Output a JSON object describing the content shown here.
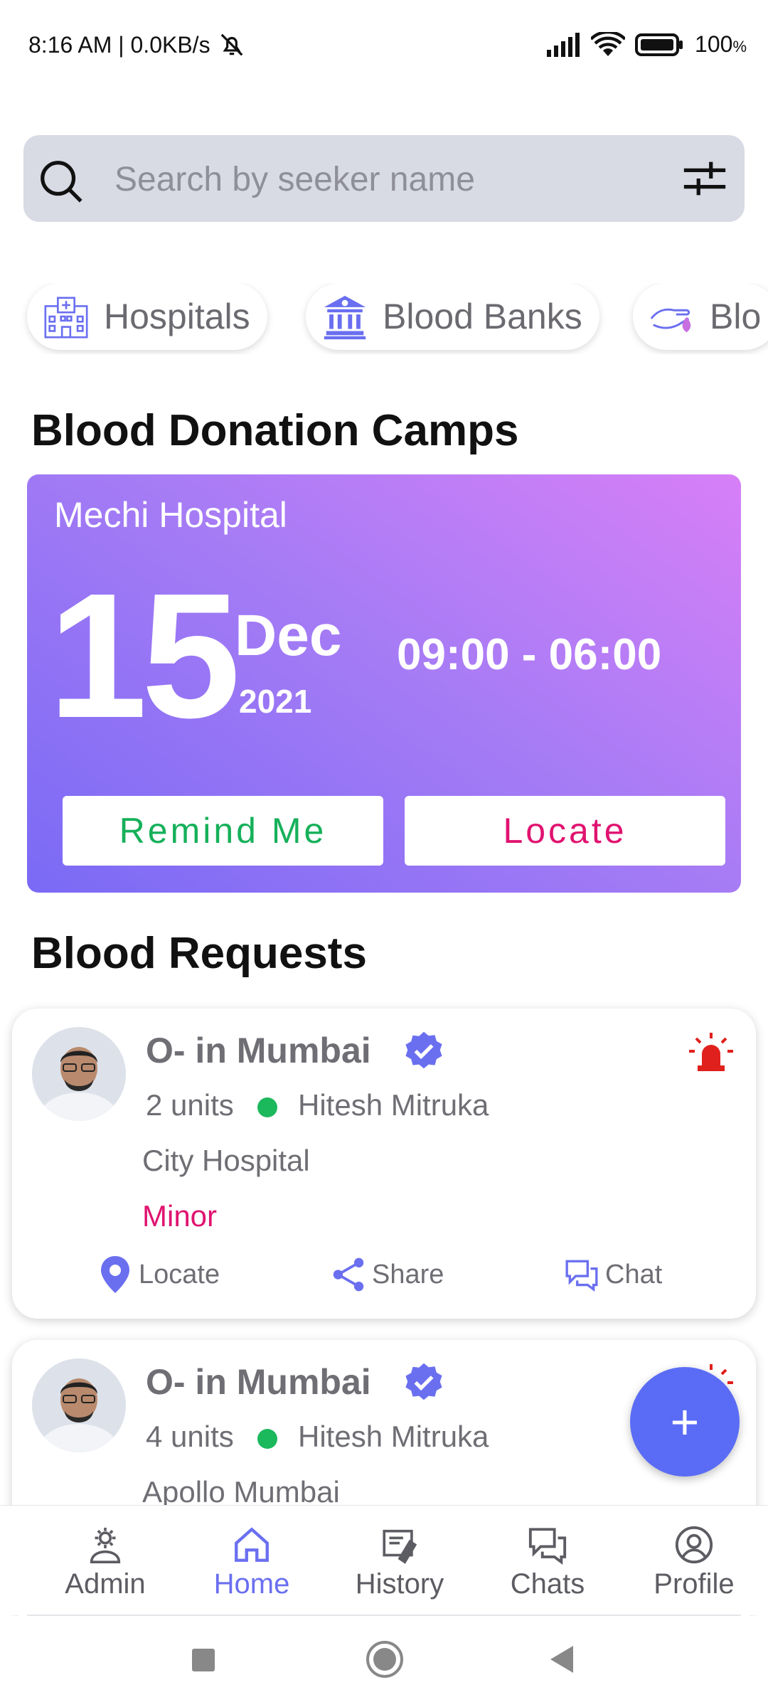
{
  "status_bar": {
    "time": "8:16 AM | 0.0KB/s",
    "battery": "100",
    "battery_unit": "%",
    "icons": [
      "mute-bell-icon",
      "signal-icon",
      "wifi-icon",
      "battery-icon"
    ]
  },
  "search": {
    "placeholder": "Search by seeker name",
    "icons": [
      "search-icon",
      "filter-icon"
    ]
  },
  "categories": [
    {
      "label": "Hospitals",
      "icon": "hospital-icon"
    },
    {
      "label": "Blood Banks",
      "icon": "bank-icon"
    },
    {
      "label": "Blo",
      "icon": "blood-donor-icon"
    }
  ],
  "camps_section": {
    "title": "Blood Donation Camps",
    "camp": {
      "place": "Mechi Hospital",
      "day": "15",
      "month": "Dec",
      "year": "2021",
      "time": "09:00 - 06:00",
      "remind_label": "Remind Me",
      "locate_label": "Locate"
    }
  },
  "requests_section": {
    "title": "Blood Requests",
    "requests": [
      {
        "title": "O- in Mumbai",
        "units": "2 units",
        "seeker": "Hitesh Mitruka",
        "hospital": "City Hospital",
        "severity": "Minor",
        "actions": {
          "locate": "Locate",
          "share": "Share",
          "chat": "Chat"
        }
      },
      {
        "title": "O- in Mumbai",
        "units": "4 units",
        "seeker": "Hitesh Mitruka",
        "hospital": "Apollo Mumbai"
      }
    ]
  },
  "fab": {
    "label": "+"
  },
  "bottom_nav": {
    "items": [
      {
        "label": "Admin",
        "icon": "admin-gear-icon"
      },
      {
        "label": "Home",
        "icon": "home-icon",
        "active": true
      },
      {
        "label": "History",
        "icon": "history-icon"
      },
      {
        "label": "Chats",
        "icon": "chats-icon"
      },
      {
        "label": "Profile",
        "icon": "profile-icon"
      }
    ]
  },
  "colors": {
    "accent": "#6a6ff0",
    "camp_gradient_start": "#7a6af5",
    "camp_gradient_end": "#d77ff7",
    "remind_green": "#16b05a",
    "locate_pink": "#e01370",
    "fab_blue": "#5a6cf5",
    "alarm_red": "#e0201c"
  }
}
